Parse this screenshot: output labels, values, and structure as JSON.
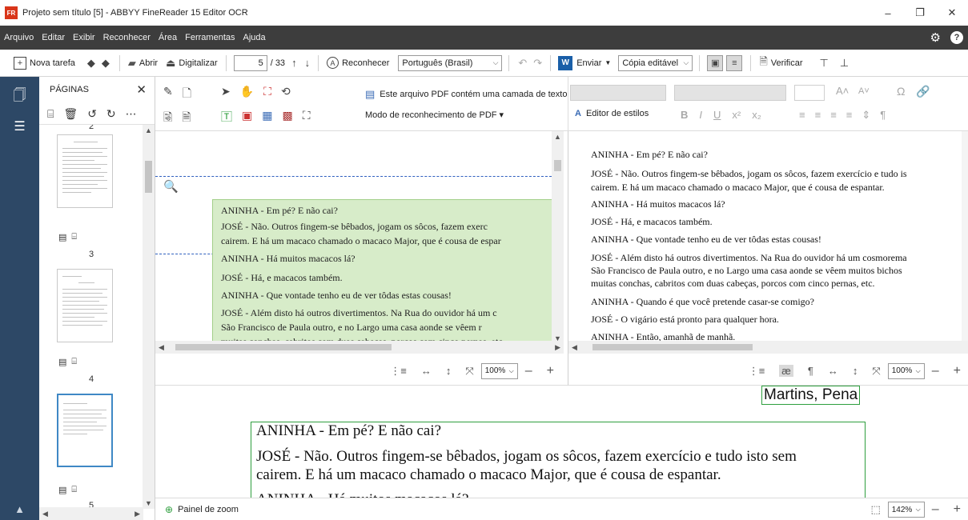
{
  "window": {
    "title": "Projeto sem título [5] - ABBYY FineReader 15 Editor OCR",
    "logo": "FR",
    "controls": [
      "–",
      "❐",
      "✕"
    ]
  },
  "menu": [
    "Arquivo",
    "Editar",
    "Exibir",
    "Reconhecer",
    "Área",
    "Ferramentas",
    "Ajuda"
  ],
  "toolbar": {
    "new_task": "Nova tarefa",
    "open": "Abrir",
    "scan": "Digitalizar",
    "page_current": "5",
    "page_total": "/ 33",
    "recognize": "Reconhecer",
    "language": "Português (Brasil)",
    "send": "Enviar",
    "output_mode": "Cópia editável",
    "verify": "Verificar"
  },
  "pages_panel": {
    "title": "PÁGINAS",
    "page_labels": [
      "2",
      "3",
      "4",
      "5"
    ]
  },
  "edit_tools": {
    "pdf_note": "Este arquivo PDF contém uma camada de texto",
    "pdf_mode": "Modo de reconhecimento de PDF ▾"
  },
  "style_bar": {
    "style_editor": "Editor de estilos"
  },
  "image_pane": {
    "lines": [
      "ANINHA - Em pé? E não cai?",
      "JOSÉ - Não. Outros fingem-se bêbados, jogam os sôcos, fazem exerc",
      "cairem. E há um macaco chamado o macaco Major, que é cousa de espar",
      "ANINHA - Há muitos macacos lá?",
      "JOSÉ - Há, e macacos também.",
      "ANINHA - Que vontade tenho eu de ver tôdas estas cousas!",
      "JOSÉ - Além disto há outros divertimentos. Na Rua do ouvidor há um c",
      "São Francisco de Paula outro, e no Largo uma casa aonde se vêem r",
      "muitas conchas, cabritos com duas cabeças, porcos com cinco pernas, etc"
    ]
  },
  "text_pane": {
    "lines": [
      "ANINHA - Em pé? E não cai?",
      "JOSÉ - Não. Outros fingem-se bêbados, jogam os sôcos, fazem exercício e tudo is",
      "cairem. E há um macaco chamado o macaco Major, que é cousa de espantar.",
      "ANINHA - Há muitos macacos lá?",
      "JOSÉ - Há, e macacos também.",
      "ANINHA - Que vontade tenho eu de ver tôdas estas cousas!",
      "JOSÉ - Além disto há outros divertimentos. Na Rua do ouvidor há um cosmorema",
      "São Francisco de Paula outro, e no Largo uma casa aonde se vêem muitos bichos",
      "muitas conchas, cabritos com duas cabeças, porcos com cinco pernas, etc.",
      "ANINHA - Quando é que você pretende casar-se comigo?",
      "JOSÉ - O vigário está pronto para qualquer hora.",
      "ANINHA - Então, amanhã de manhã."
    ]
  },
  "zoom": {
    "image_zoom": "100%",
    "text_zoom": "100%",
    "zoom_pane_zoom": "142%"
  },
  "zoom_pane": {
    "caption": "Martins, Pena",
    "lines": [
      "ANINHA - Em pé? E não cai?",
      "JOSÉ - Não. Outros fingem-se bêbados, jogam os sôcos, fazem exercício e tudo isto sem",
      "cairem. E há um macaco chamado o macaco Major, que é cousa de espantar.",
      "ANINHA - Há muitos macacos lá?"
    ]
  },
  "status": {
    "zoom_panel": "Painel de zoom"
  },
  "colors": {
    "menubar": "#3d3d3d",
    "sidebar": "#2d4866",
    "text_block": "#d7ecc9",
    "selection": "#3f88c5",
    "zoom_frame": "#2e9e3e"
  }
}
